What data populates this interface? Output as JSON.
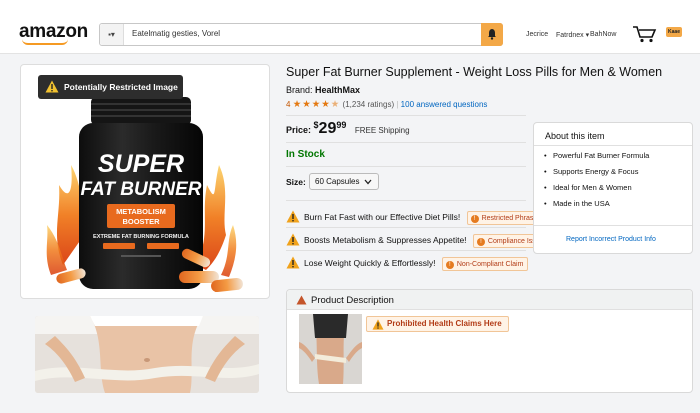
{
  "header": {
    "logo": "amazon",
    "search_dropdown": "▪▾",
    "search_value": "Eatelmatig gesties, Vorel",
    "nav": [
      "Jecrice",
      "Fatrdnex ▾",
      "BahNow"
    ],
    "cart_badge": "Kaae"
  },
  "image_panel": {
    "warning_badge": "Potentially Restricted Image",
    "bottle": {
      "line1": "SUPER",
      "line2": "FAT BURNER",
      "label_line1": "METABOLISM",
      "label_line2": "BOOSTER",
      "sub": "EXTREME FAT BURNING FORMULA"
    }
  },
  "product": {
    "title": "Super Fat Burner Supplement - Weight Loss Pills for Men & Women",
    "brand_label": "Brand:",
    "brand": "HealthMax",
    "rating_value": "4",
    "stars": "★★★★",
    "star_half": "★",
    "ratings_count": "(1,234 ratings)",
    "answered": "100 answered questions",
    "price_label": "Price:",
    "price_dollar": "$",
    "price_whole": "29",
    "price_cents": "99",
    "shipping": "FREE Shipping",
    "stock": "In Stock",
    "size_label": "Size:",
    "size_value": "60 Capsules"
  },
  "claims": [
    {
      "text": "Burn Fat Fast with our Effective Diet Pills!",
      "tag": "Restricted Phrase"
    },
    {
      "text": "Boosts Metabolism & Suppresses Appetite!",
      "tag": "Compliance Issue"
    },
    {
      "text": "Lose Weight Quickly & Effortlessly!",
      "tag": "Non-Compliant Claim"
    }
  ],
  "about": {
    "title": "About this item",
    "items": [
      "Powerful Fat Burner Formula",
      "Supports Energy & Focus",
      "Ideal for Men & Women",
      "Made in the USA"
    ]
  },
  "report_link": "Report Incorrect Product Info",
  "description": {
    "title": "Product Description",
    "flag": "Prohibited Health Claims Here"
  },
  "colors": {
    "accent": "#f3a847",
    "link": "#0066c0",
    "warning": "#e57b20",
    "stock": "#007600"
  }
}
